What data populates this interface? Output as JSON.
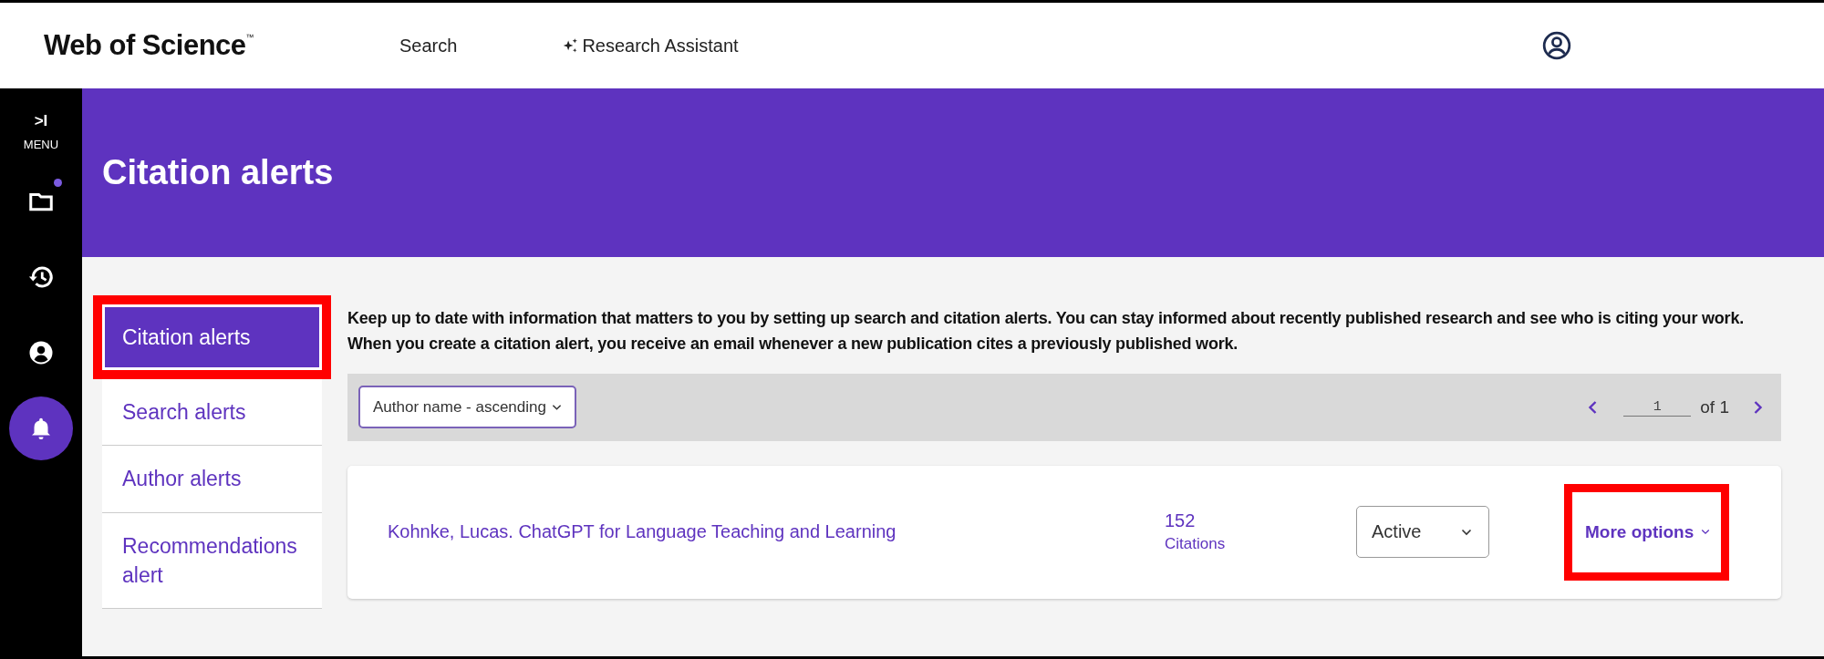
{
  "header": {
    "logo": "Web of Science",
    "logo_mark": "™",
    "nav": [
      {
        "label": "Search",
        "kind": "plain"
      },
      {
        "label": "Research Assistant",
        "kind": "sparkle"
      }
    ]
  },
  "sidebar": {
    "toggle": ">I",
    "menu_label": "MENU",
    "items": [
      {
        "kind": "folder",
        "badge": true,
        "selected": false
      },
      {
        "kind": "history",
        "badge": false,
        "selected": false
      },
      {
        "kind": "account",
        "badge": false,
        "selected": false
      },
      {
        "kind": "bell",
        "badge": false,
        "selected": true
      }
    ]
  },
  "banner": {
    "title": "Citation alerts"
  },
  "alert_nav": [
    {
      "label": "Citation alerts",
      "selected": true,
      "highlighted": true
    },
    {
      "label": "Search alerts",
      "selected": false,
      "highlighted": false
    },
    {
      "label": "Author alerts",
      "selected": false,
      "highlighted": false
    },
    {
      "label": "Recommendations alert",
      "selected": false,
      "highlighted": false
    }
  ],
  "description": "Keep up to date with information that matters to you by setting up search and citation alerts. You can stay informed about recently published research and see who is citing your work. When you create a citation alert, you receive an email whenever a new publication cites a previously published work.",
  "toolbar": {
    "sort": "Author name - ascending",
    "page": "1",
    "page_total": "of 1"
  },
  "alerts": [
    {
      "title": "Kohnke, Lucas. ChatGPT for Language Teaching and Learning",
      "count": "152",
      "count_label": "Citations",
      "status": "Active",
      "more": "More options",
      "more_highlighted": true
    }
  ]
}
